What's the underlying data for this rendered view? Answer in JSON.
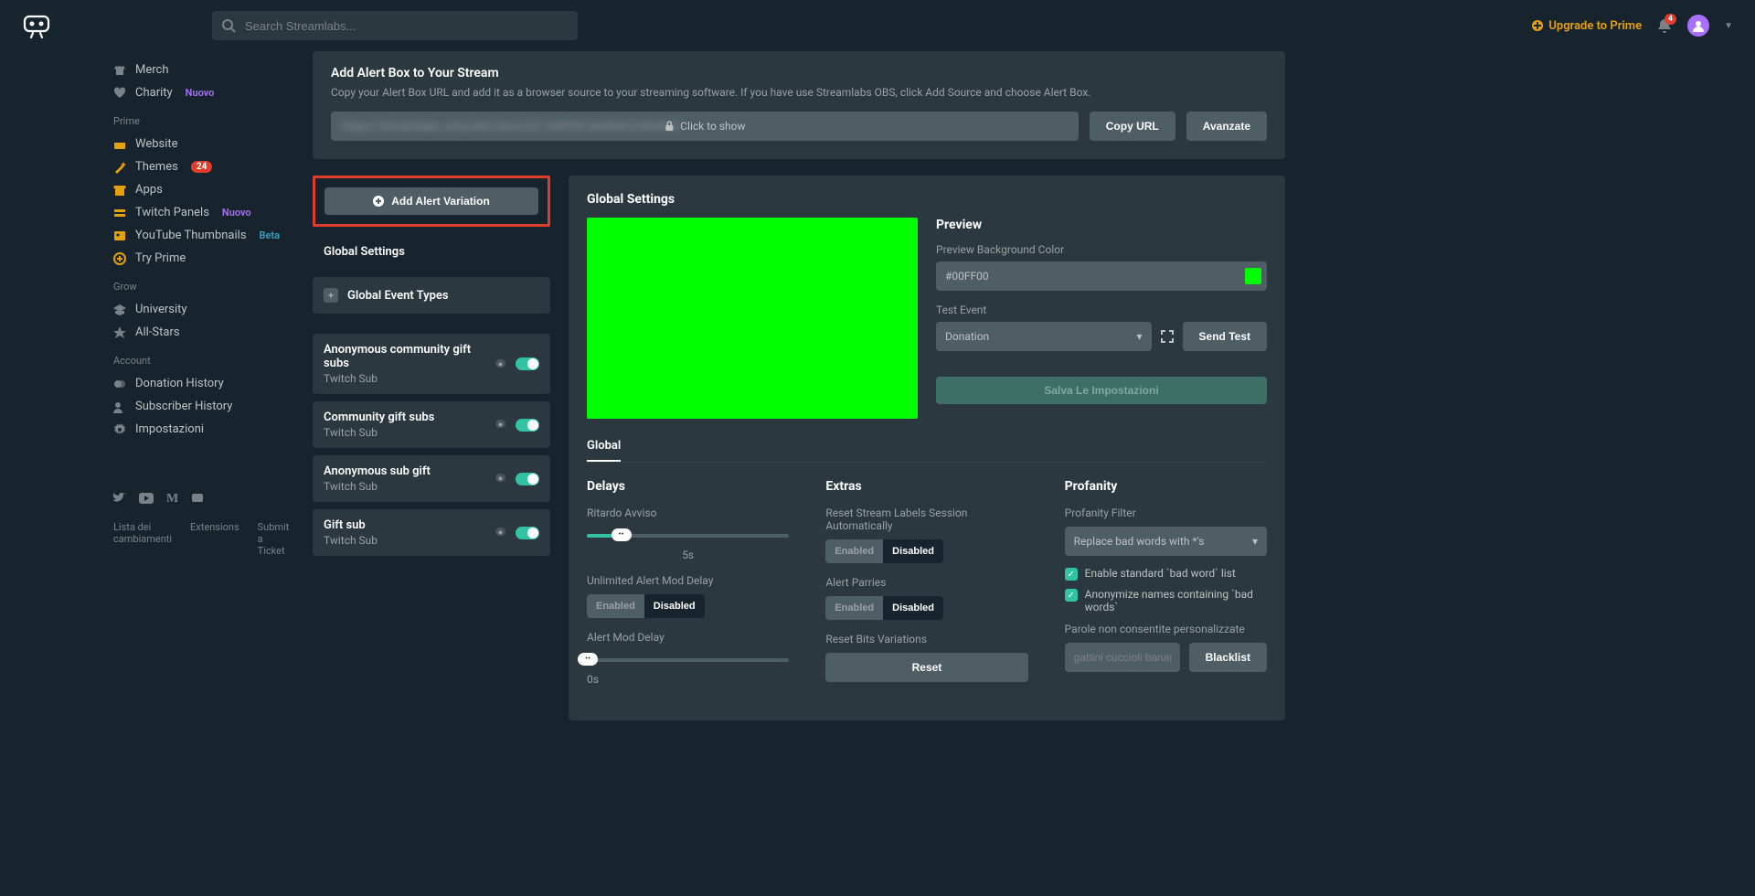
{
  "header": {
    "search_placeholder": "Search Streamlabs...",
    "upgrade": "Upgrade to Prime",
    "bell_count": "4"
  },
  "sidebar": {
    "top_items": [
      {
        "label": "Merch",
        "badge": ""
      },
      {
        "label": "Charity",
        "badge": "Nuovo"
      }
    ],
    "sections": [
      {
        "title": "Prime",
        "items": [
          {
            "label": "Website",
            "badge": ""
          },
          {
            "label": "Themes",
            "badge_count": "24"
          },
          {
            "label": "Apps",
            "badge": ""
          },
          {
            "label": "Twitch Panels",
            "badge": "Nuovo"
          },
          {
            "label": "YouTube Thumbnails",
            "badge_beta": "Beta"
          },
          {
            "label": "Try Prime",
            "badge": ""
          }
        ]
      },
      {
        "title": "Grow",
        "items": [
          {
            "label": "University"
          },
          {
            "label": "All-Stars"
          }
        ]
      },
      {
        "title": "Account",
        "items": [
          {
            "label": "Donation History"
          },
          {
            "label": "Subscriber History"
          },
          {
            "label": "Impostazioni"
          }
        ]
      }
    ],
    "footer_links": [
      "Lista dei cambiamenti",
      "Extensions",
      "Submit a Ticket"
    ]
  },
  "info_card": {
    "title": "Add Alert Box to Your Stream",
    "desc": "Copy your Alert Box URL and add it as a browser source to your streaming software. If you have use Streamlabs OBS, click Add Source and choose Alert Box.",
    "blurred_url": "https://streamlabs.com/alert-box/v3/1A8FPA1A64b4CC08A8A9",
    "click_to_show": "Click to show",
    "copy_btn": "Copy URL",
    "advanced_btn": "Avanzate"
  },
  "left_col": {
    "add_variation": "Add Alert Variation",
    "global_settings": "Global Settings",
    "global_event_types": "Global Event Types",
    "variations": [
      {
        "title": "Anonymous community gift subs",
        "sub": "Twitch Sub"
      },
      {
        "title": "Community gift subs",
        "sub": "Twitch Sub"
      },
      {
        "title": "Anonymous sub gift",
        "sub": "Twitch Sub"
      },
      {
        "title": "Gift sub",
        "sub": "Twitch Sub"
      }
    ]
  },
  "right_col": {
    "heading": "Global Settings",
    "preview": {
      "title": "Preview",
      "bg_label": "Preview Background Color",
      "bg_value": "#00FF00",
      "test_label": "Test Event",
      "test_value": "Donation",
      "send_btn": "Send Test",
      "save_btn": "Salva Le Impostazioni"
    },
    "tab": "Global",
    "delays": {
      "heading": "Delays",
      "ritardo_label": "Ritardo Avviso",
      "ritardo_value": "5s",
      "unlimited_label": "Unlimited Alert Mod Delay",
      "enabled": "Enabled",
      "disabled": "Disabled",
      "mod_delay_label": "Alert Mod Delay",
      "mod_delay_value": "0s"
    },
    "extras": {
      "heading": "Extras",
      "reset_labels": "Reset Stream Labels Session Automatically",
      "parries": "Alert Parries",
      "reset_bits": "Reset Bits Variations",
      "reset_btn": "Reset"
    },
    "profanity": {
      "heading": "Profanity",
      "filter_label": "Profanity Filter",
      "filter_value": "Replace bad words with *'s",
      "check1": "Enable standard `bad word` list",
      "check2": "Anonymize names containing `bad words`",
      "custom_label": "Parole non consentite personalizzate",
      "placeholder": "gattini cuccioli banane",
      "blacklist_btn": "Blacklist"
    }
  }
}
